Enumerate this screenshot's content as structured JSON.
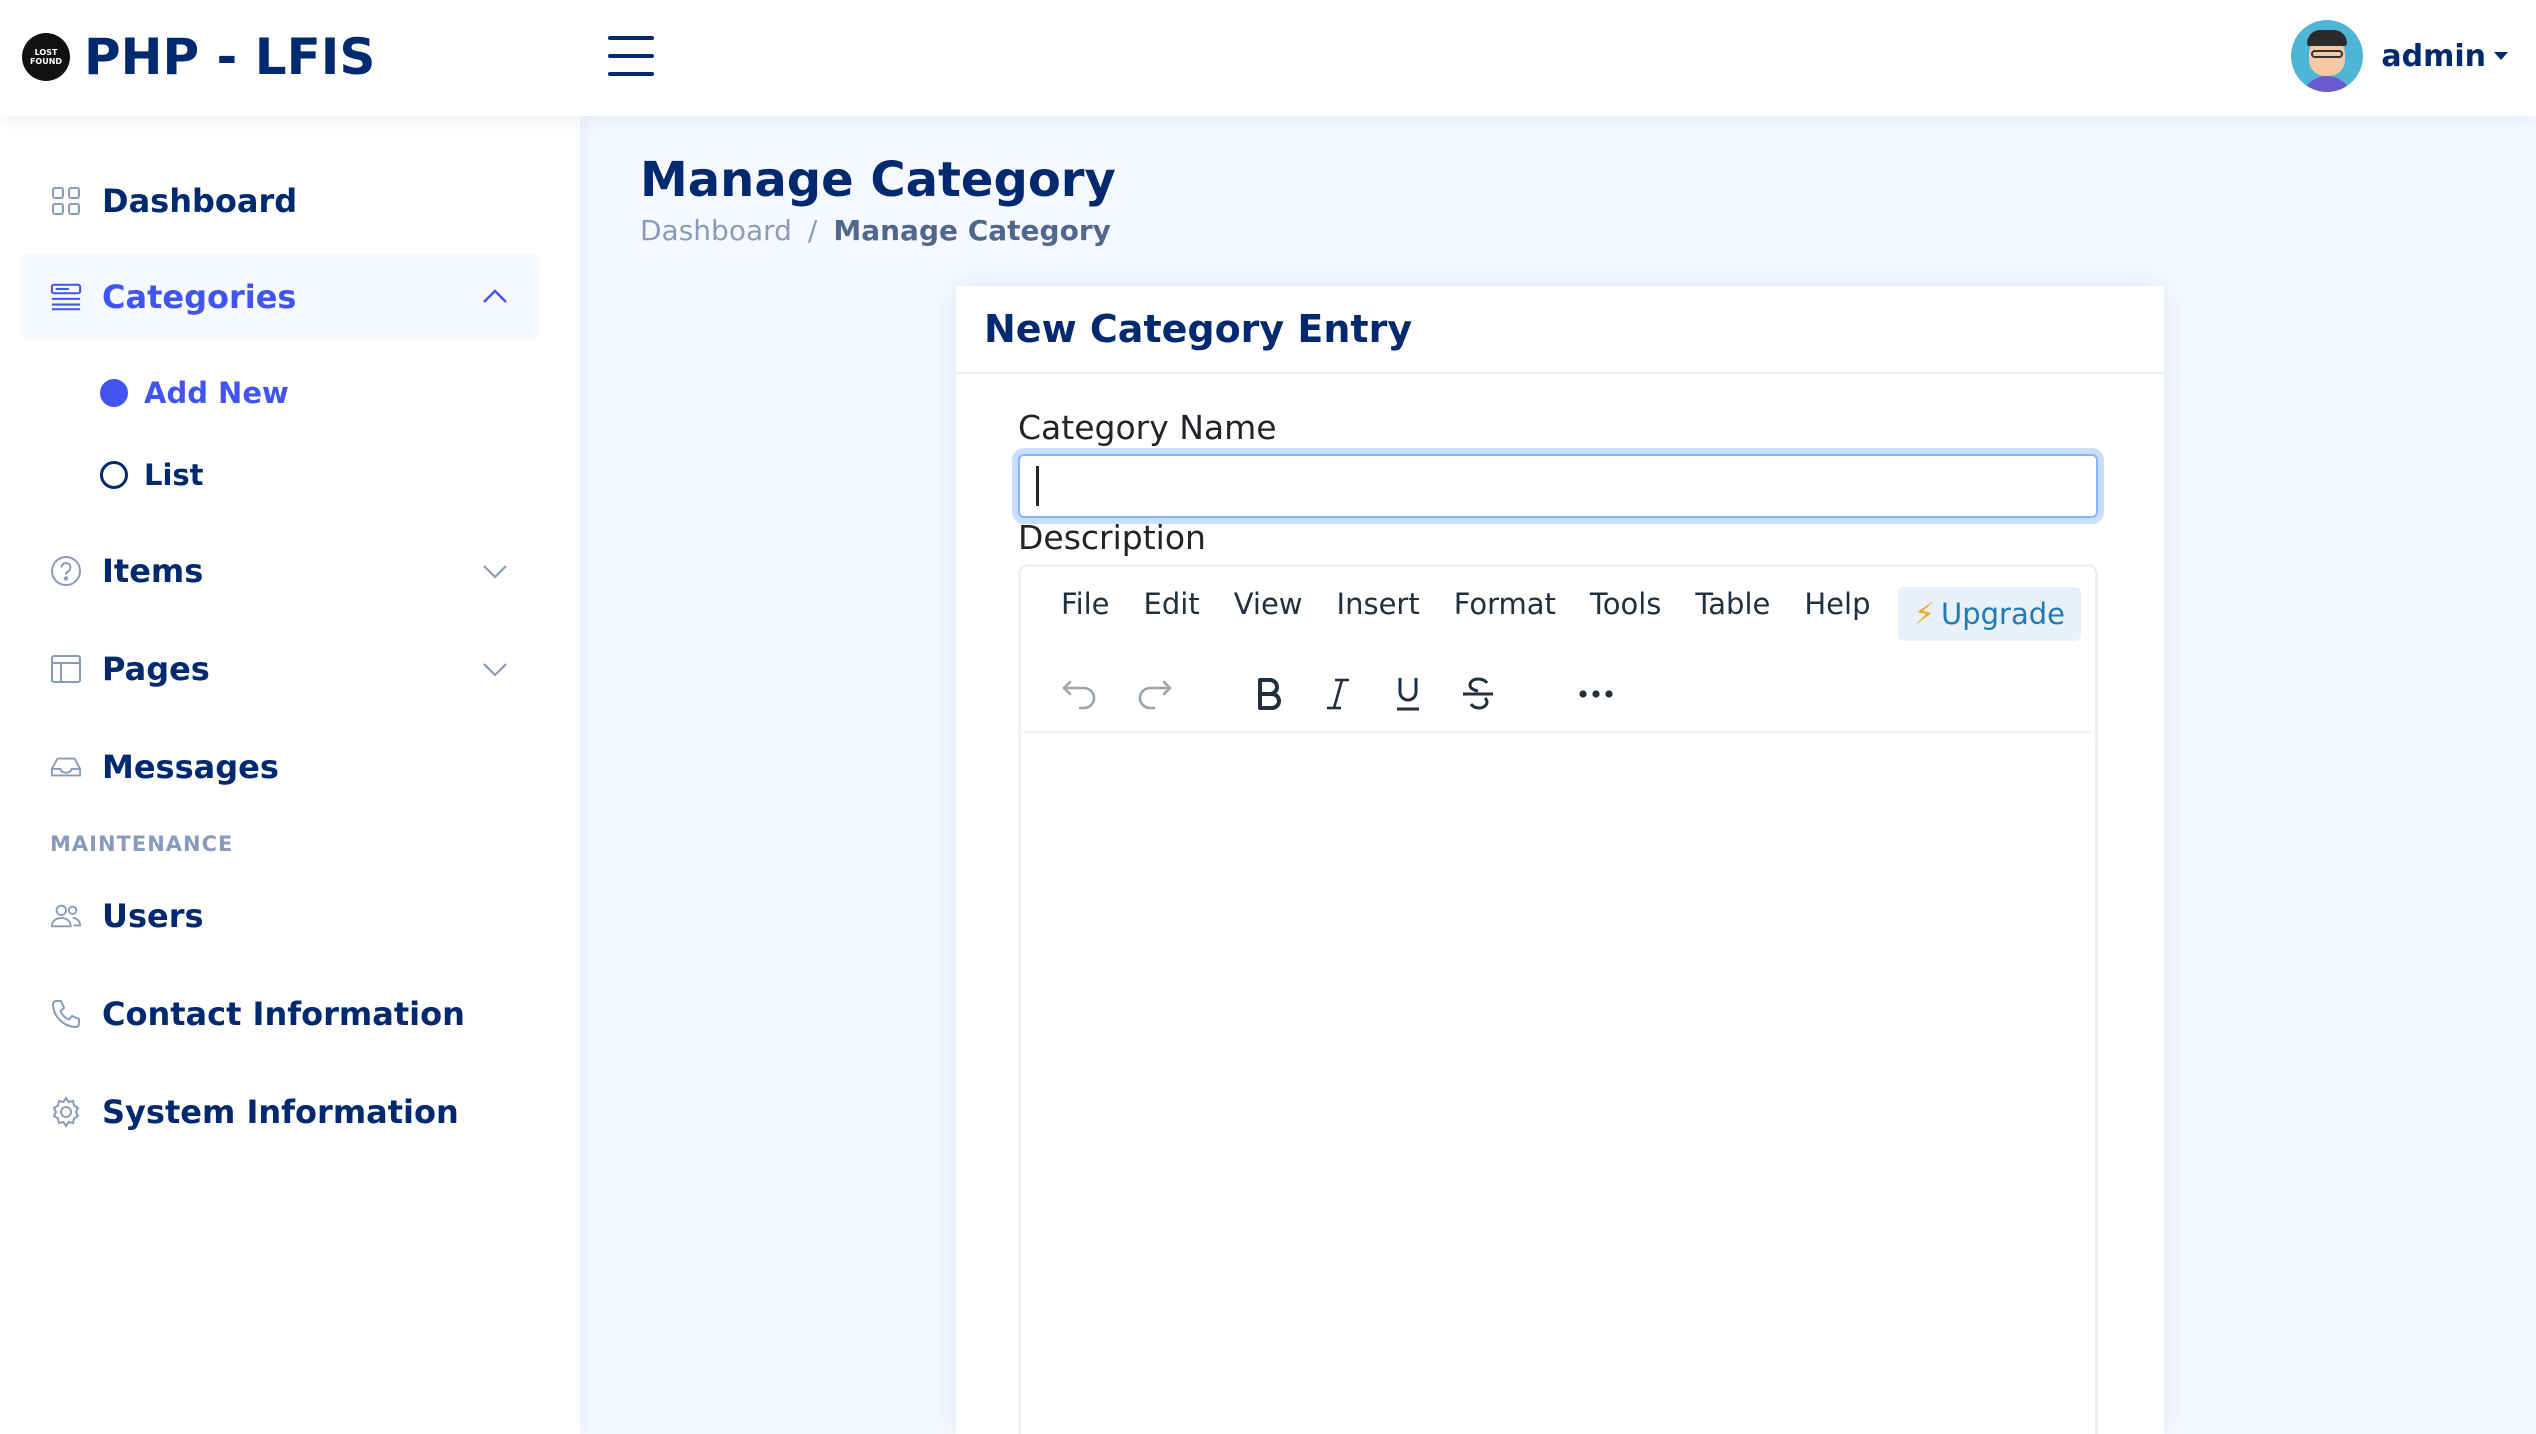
{
  "app": {
    "title": "PHP - LFIS",
    "logo_text": "LOST FOUND"
  },
  "header": {
    "user_name": "admin"
  },
  "sidebar": {
    "items": [
      {
        "label": "Dashboard",
        "icon": "grid-icon"
      },
      {
        "label": "Categories",
        "icon": "menu-button-icon",
        "expanded": true
      },
      {
        "label": "Items",
        "icon": "question-circle-icon"
      },
      {
        "label": "Pages",
        "icon": "layout-icon"
      },
      {
        "label": "Messages",
        "icon": "inbox-icon"
      }
    ],
    "sub_items": [
      {
        "label": "Add New",
        "active": true
      },
      {
        "label": "List",
        "active": false
      }
    ],
    "maintenance_heading": "MAINTENANCE",
    "maintenance_items": [
      {
        "label": "Users",
        "icon": "people-icon"
      },
      {
        "label": "Contact Information",
        "icon": "telephone-icon"
      },
      {
        "label": "System Information",
        "icon": "gear-icon"
      }
    ]
  },
  "main": {
    "page_title": "Manage Category",
    "breadcrumb": [
      "Dashboard",
      "Manage Category"
    ],
    "breadcrumb_separator": "/",
    "card_title": "New Category Entry",
    "category_label": "Category Name",
    "category_value": "",
    "description_label": "Description",
    "editor": {
      "menu": [
        "File",
        "Edit",
        "View",
        "Insert",
        "Format",
        "Tools",
        "Table",
        "Help"
      ],
      "upgrade_label": "Upgrade",
      "toolbar": [
        "undo-icon",
        "redo-icon",
        "bold-icon",
        "italic-icon",
        "underline-icon",
        "strikethrough-icon",
        "more-icon"
      ]
    }
  },
  "colors": {
    "primary": "#4154f1",
    "navy": "#012970",
    "muted": "#899bbd",
    "page_bg": "#f6f9ff"
  }
}
